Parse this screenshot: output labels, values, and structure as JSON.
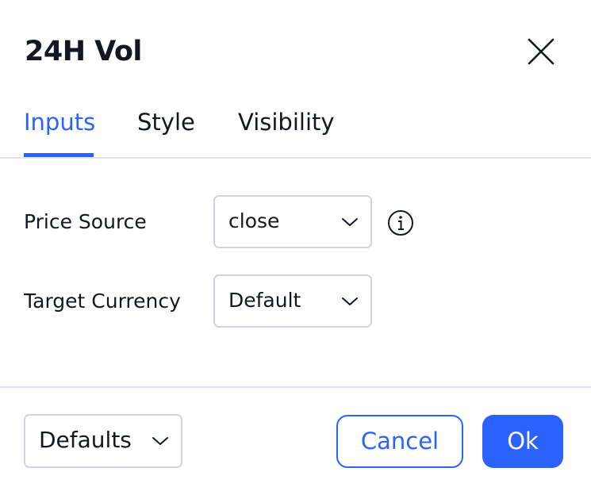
{
  "dialog": {
    "title": "24H Vol",
    "close_icon": "close-icon"
  },
  "tabs": [
    {
      "label": "Inputs",
      "active": true
    },
    {
      "label": "Style",
      "active": false
    },
    {
      "label": "Visibility",
      "active": false
    }
  ],
  "inputs": {
    "price_source": {
      "label": "Price Source",
      "value": "close"
    },
    "target_currency": {
      "label": "Target Currency",
      "value": "Default"
    }
  },
  "footer": {
    "defaults_label": "Defaults",
    "cancel_label": "Cancel",
    "ok_label": "Ok"
  },
  "colors": {
    "accent": "#2962ff",
    "text": "#131722",
    "border": "#d1d4dc",
    "divider": "#e0e3eb"
  }
}
